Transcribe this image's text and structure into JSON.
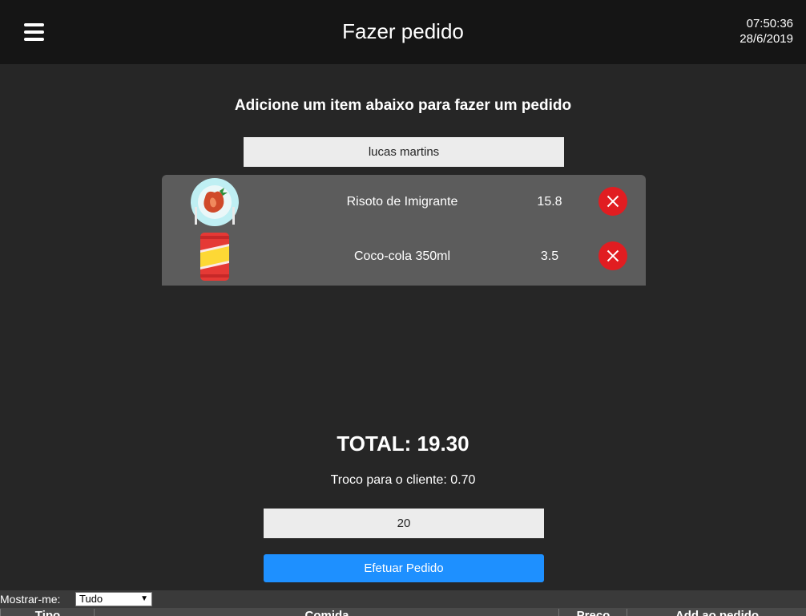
{
  "header": {
    "title": "Fazer pedido",
    "time": "07:50:36",
    "date": "28/6/2019",
    "menu_icon": "hamburger-menu-icon"
  },
  "main": {
    "instruction": "Adicione um item abaixo para fazer um pedido",
    "client_name": "lucas martins",
    "items": [
      {
        "name": "Risoto de Imigrante",
        "price": "15.8",
        "icon": "risotto-plate-icon"
      },
      {
        "name": "Coco-cola 350ml",
        "price": "3.5",
        "icon": "soda-can-icon"
      }
    ],
    "total": "TOTAL: 19.30",
    "change": "Troco para o cliente: 0.70",
    "amount_paid": "20",
    "submit_label": "Efetuar Pedido"
  },
  "filter": {
    "label": "Mostrar-me:",
    "selected": "Tudo"
  },
  "table": {
    "columns": [
      "Tipo",
      "Comida",
      "Preço",
      "Add ao pedido"
    ]
  },
  "colors": {
    "accent": "#1e90ff",
    "remove": "#e11d21",
    "background": "#262626",
    "header": "#151515"
  }
}
